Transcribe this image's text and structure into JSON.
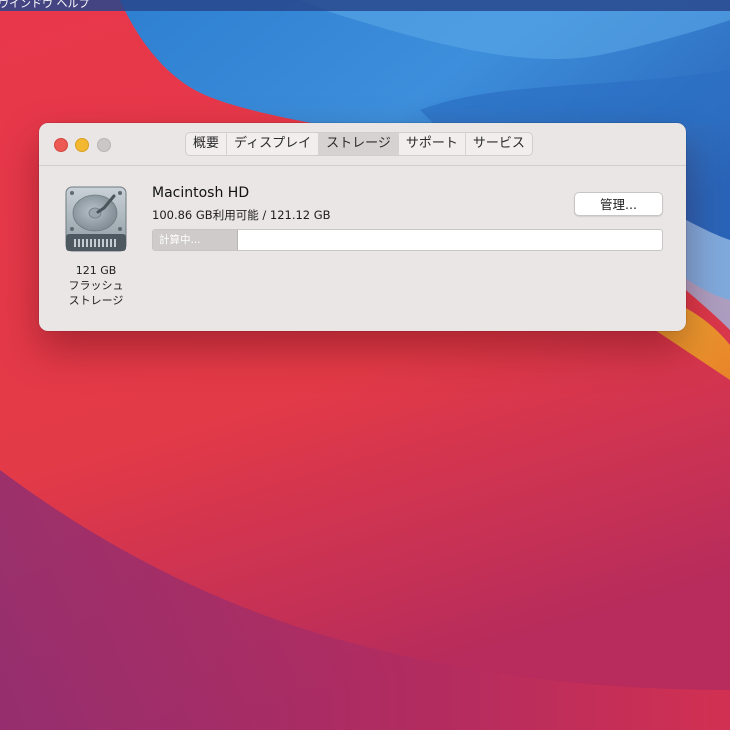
{
  "menubar": {
    "text": "ウインドウ  ヘルプ"
  },
  "window": {
    "tabs": [
      {
        "label": "概要",
        "active": false
      },
      {
        "label": "ディスプレイ",
        "active": false
      },
      {
        "label": "ストレージ",
        "active": true
      },
      {
        "label": "サポート",
        "active": false
      },
      {
        "label": "サービス",
        "active": false
      }
    ],
    "disk": {
      "icon": "hard-drive-icon",
      "capacity": "121 GB",
      "type_line1": "フラッシュ",
      "type_line2": "ストレージ"
    },
    "volume": {
      "name": "Macintosh HD",
      "usage": "100.86 GB利用可能 / 121.12 GB"
    },
    "manage_button": "管理...",
    "storage_bar": {
      "label": "計算中...",
      "fill_fraction": 0.165
    }
  },
  "colors": {
    "close": "#ec5a53",
    "minimize": "#f3b82f",
    "zoom": "#cbc7c7",
    "window_bg": "#eae6e6"
  }
}
